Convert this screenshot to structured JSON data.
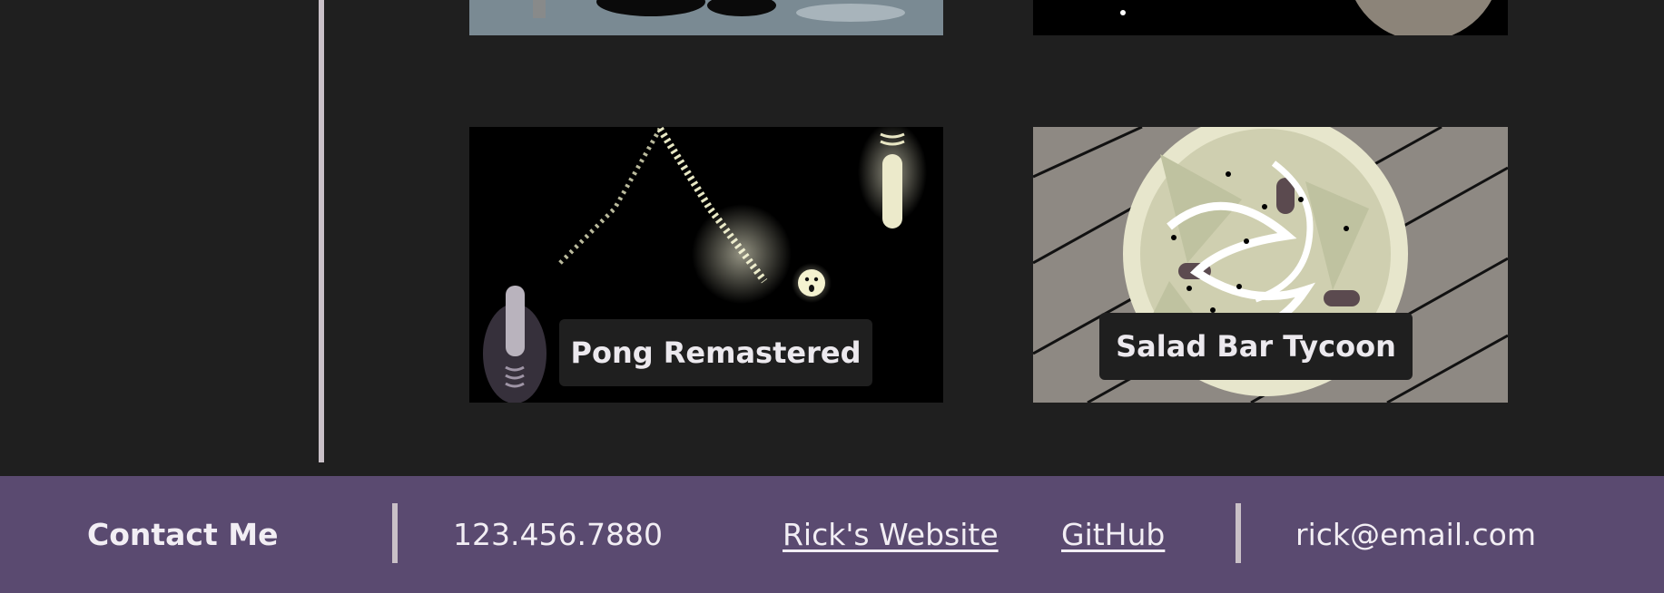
{
  "projects": [
    {
      "title": "Pong Remastered"
    },
    {
      "title": "Salad Bar Tycoon"
    }
  ],
  "footer": {
    "heading": "Contact Me",
    "phone": "123.456.7880",
    "website_label": "Rick's Website",
    "github_label": "GitHub",
    "email": "rick@email.com"
  },
  "colors": {
    "background": "#1f1f1f",
    "footer": "#5a4a70",
    "divider": "#c9c0c7"
  }
}
